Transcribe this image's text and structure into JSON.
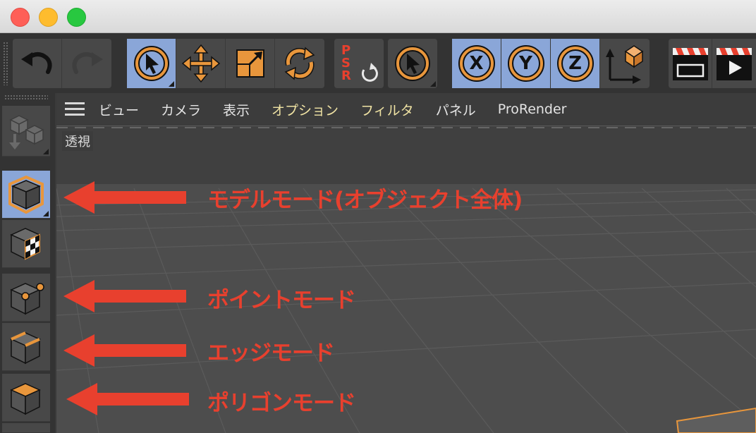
{
  "menu": {
    "items": [
      "ビュー",
      "カメラ",
      "表示",
      "オプション",
      "フィルタ",
      "パネル",
      "ProRender"
    ]
  },
  "viewport": {
    "label": "透視"
  },
  "toolbar": {
    "psr_letters": [
      "P",
      "S",
      "R"
    ],
    "axis_x": "X",
    "axis_y": "Y",
    "axis_z": "Z"
  },
  "annotations": {
    "model_mode": "モデルモード(オブジェクト全体)",
    "point_mode": "ポイントモード",
    "edge_mode": "エッジモード",
    "polygon_mode": "ポリゴンモード"
  },
  "colors": {
    "accent_orange": "#e8963c",
    "active_blue": "#8aa6d8",
    "annotation_red": "#e8402e",
    "menu_highlight": "#f0e3a4"
  },
  "icons": {
    "toolbar": [
      "undo-icon",
      "redo-icon",
      "select-arrow-icon",
      "move-icon",
      "scale-icon",
      "rotate-icon",
      "psr-reset-icon",
      "live-select-icon",
      "axis-x-icon",
      "axis-y-icon",
      "axis-z-icon",
      "coordinate-system-icon",
      "render-view-icon",
      "render-picture-viewer-icon"
    ],
    "palette": [
      "make-editable-icon",
      "model-mode-icon",
      "texture-mode-icon",
      "point-mode-icon",
      "edge-mode-icon",
      "polygon-mode-icon"
    ]
  }
}
